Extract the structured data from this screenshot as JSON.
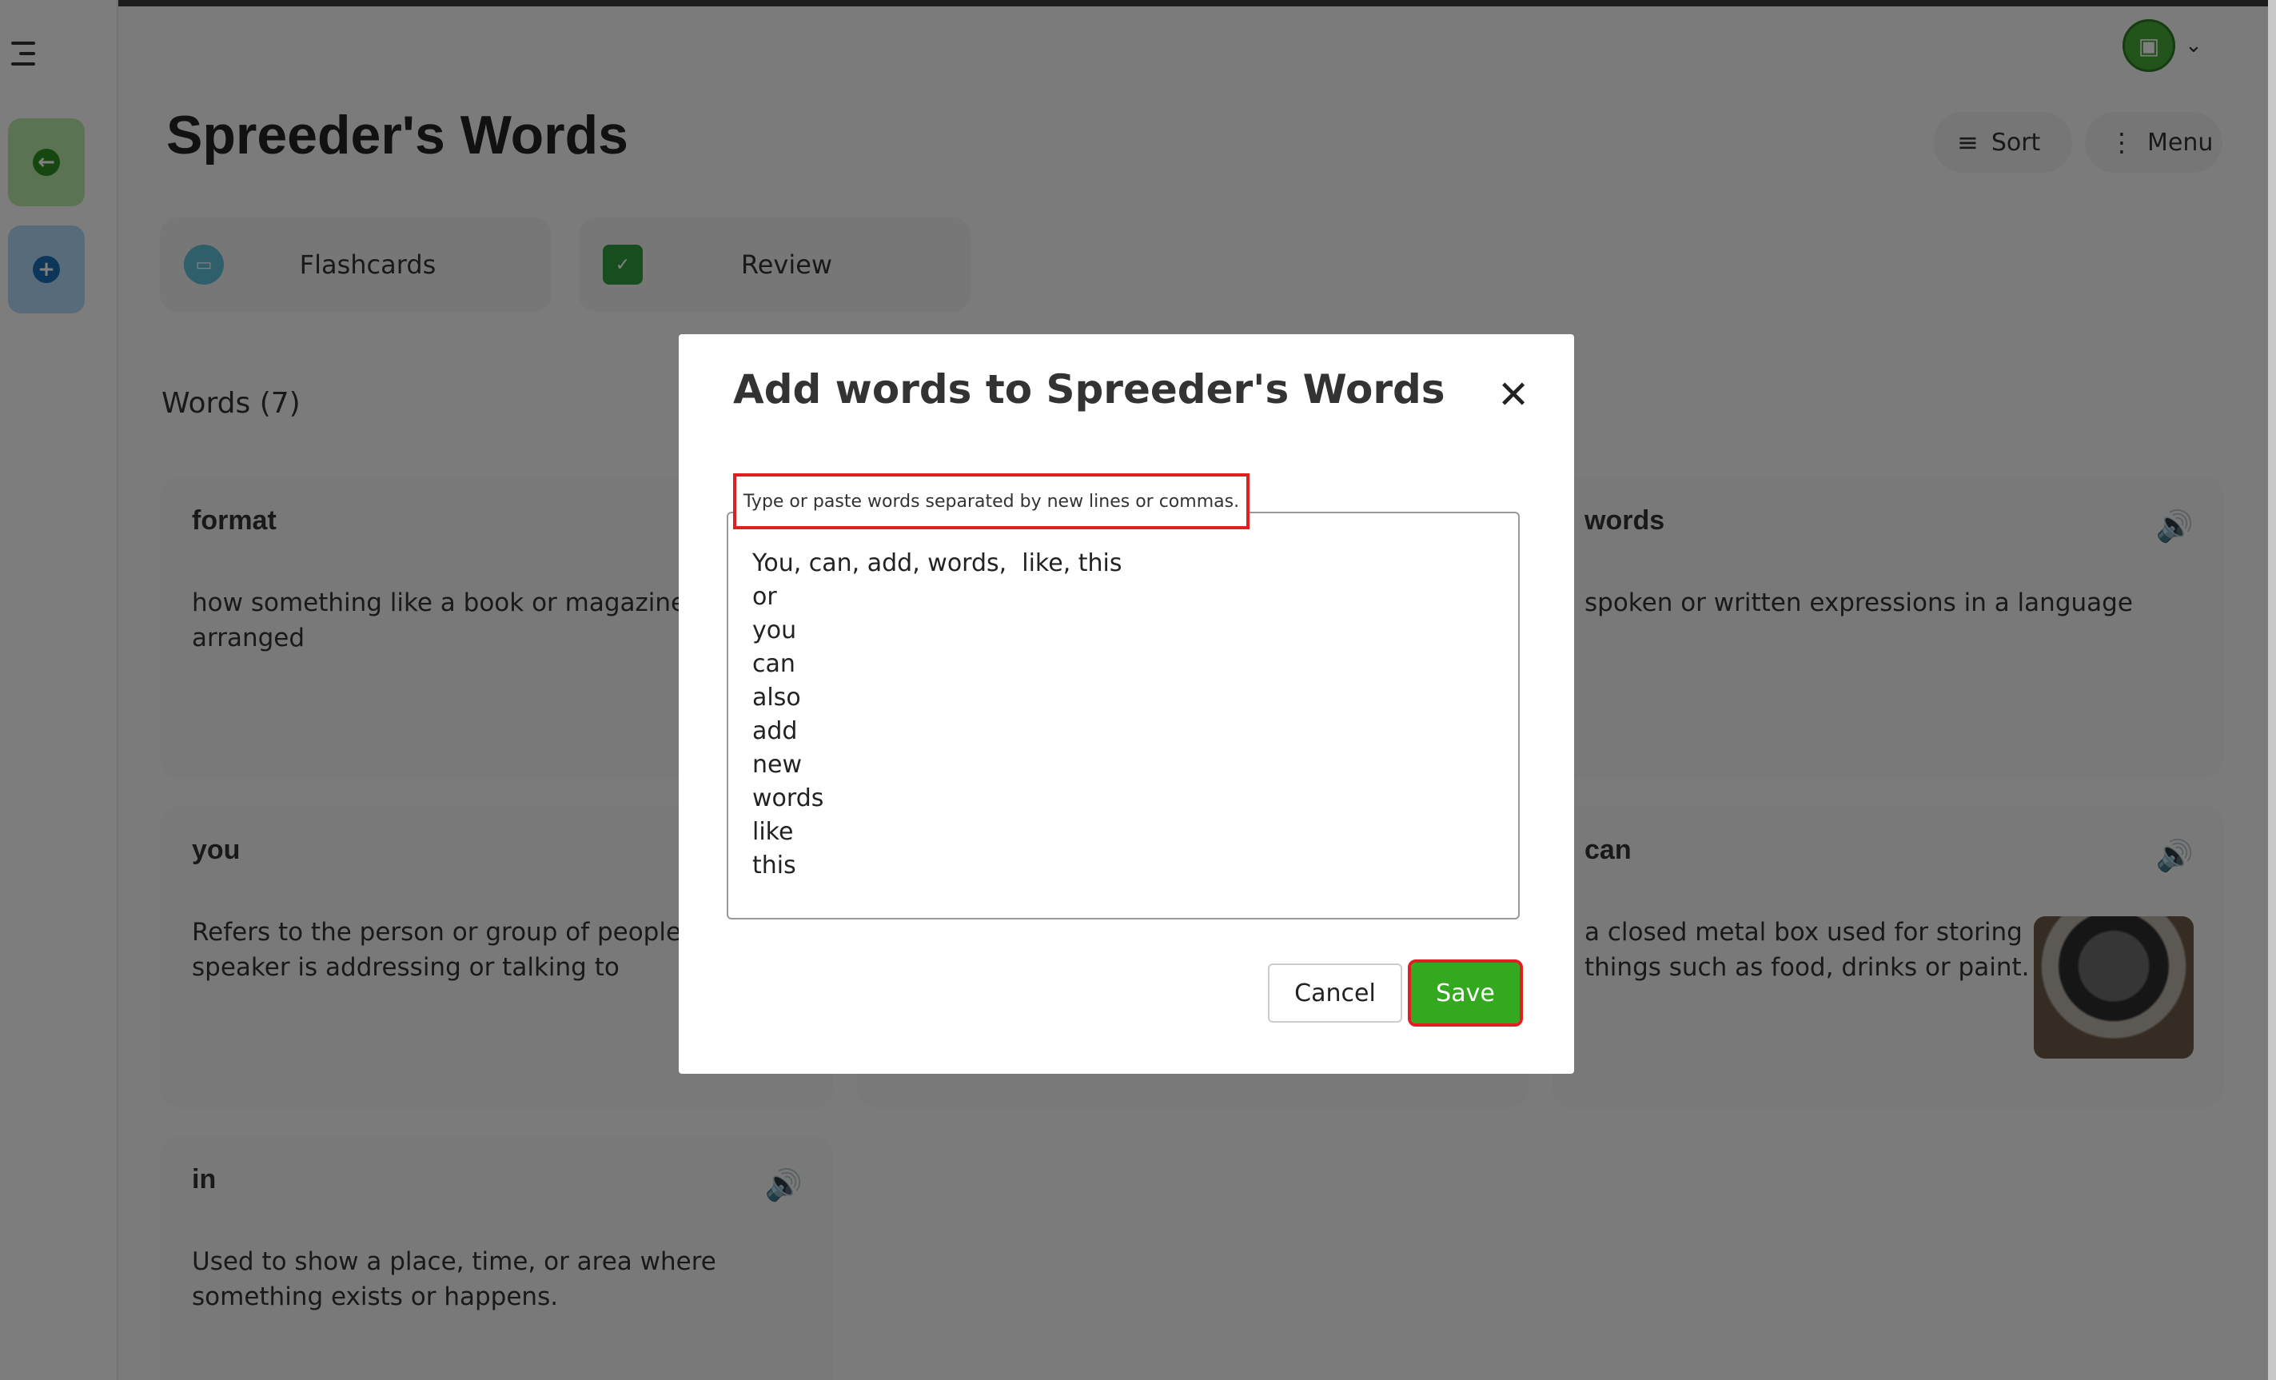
{
  "page": {
    "title": "Spreeder's Words",
    "sort_label": "Sort",
    "menu_label": "Menu",
    "modes": [
      {
        "label": "Flashcards",
        "icon": "flashcards-icon"
      },
      {
        "label": "Review",
        "icon": "checklist-icon"
      }
    ],
    "words_count_label": "Words (7)"
  },
  "cards": [
    {
      "word": "format",
      "definition": "how something like a book or magazine is arranged"
    },
    {
      "word": "words",
      "definition": "spoken or written expressions in a language"
    },
    {
      "word": "you",
      "definition": "Refers to the person or group of people the speaker is addressing or talking to"
    },
    {
      "word": "can",
      "definition": "a closed metal box used for storing things such as food, drinks or paint."
    },
    {
      "word": "in",
      "definition": "Used to show a place, time, or area where something exists or happens."
    }
  ],
  "modal": {
    "title": "Add words to Spreeder's Words",
    "field_label": "Type or paste words separated by new lines or commas.",
    "field_value": "You, can, add, words,  like, this\nor\nyou\ncan\nalso\nadd\nnew\nwords\nlike\nthis",
    "cancel_label": "Cancel",
    "save_label": "Save"
  },
  "colors": {
    "accent_green": "#34a81f",
    "highlight_red": "#e02020"
  }
}
